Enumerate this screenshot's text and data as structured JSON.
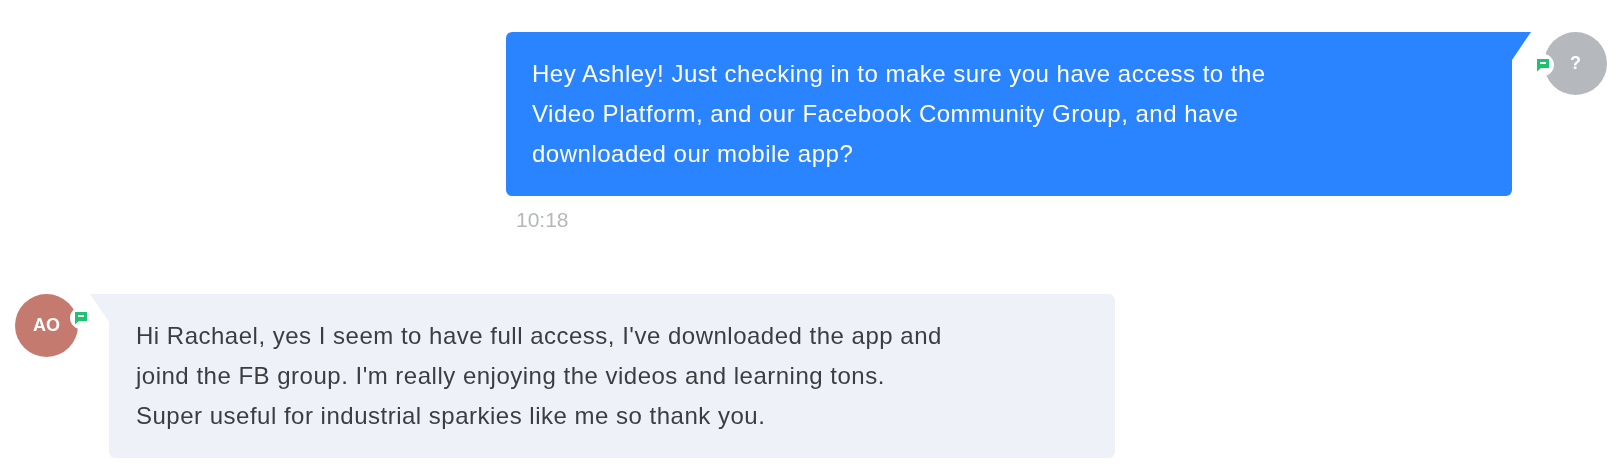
{
  "messages": [
    {
      "kind": "outgoing",
      "avatar": "?",
      "text": "Hey Ashley! Just checking in to make sure you have access to the Video Platform, and our Facebook Community Group, and have downloaded our mobile app?",
      "time": "10:18"
    },
    {
      "kind": "incoming",
      "avatar": "AO",
      "text": "Hi Rachael, yes I seem to have full access, I've downloaded the app and joind the FB group. I'm really enjoying the videos and learning tons. Super useful for industrial sparkies like me so thank you."
    }
  ]
}
